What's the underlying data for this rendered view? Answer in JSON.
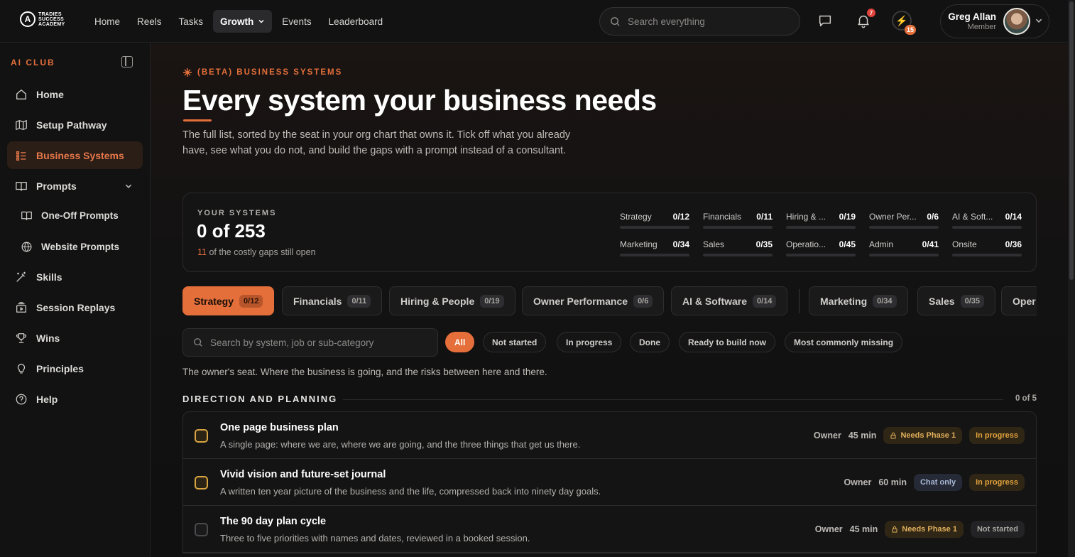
{
  "brand": {
    "mark": "A",
    "line1": "TRADIES",
    "line2": "SUCCESS",
    "line3": "ACADEMY"
  },
  "nav": [
    {
      "label": "Home"
    },
    {
      "label": "Reels"
    },
    {
      "label": "Tasks"
    },
    {
      "label": "Growth"
    },
    {
      "label": "Events"
    },
    {
      "label": "Leaderboard"
    }
  ],
  "search": {
    "placeholder": "Search everything"
  },
  "notifications": {
    "count": "7"
  },
  "streak": {
    "count": "15"
  },
  "user": {
    "name": "Greg Allan",
    "role": "Member"
  },
  "sidebar": {
    "title": "AI CLUB",
    "items": [
      {
        "label": "Home",
        "icon": "home-icon"
      },
      {
        "label": "Setup Pathway",
        "icon": "map-icon"
      },
      {
        "label": "Business Systems",
        "icon": "list-icon"
      },
      {
        "label": "Prompts",
        "icon": "book-icon"
      },
      {
        "label": "One-Off Prompts",
        "icon": "book-open-icon"
      },
      {
        "label": "Website Prompts",
        "icon": "globe-icon"
      },
      {
        "label": "Skills",
        "icon": "wand-icon"
      },
      {
        "label": "Session Replays",
        "icon": "replay-icon"
      },
      {
        "label": "Wins",
        "icon": "trophy-icon"
      },
      {
        "label": "Principles",
        "icon": "lightbulb-icon"
      },
      {
        "label": "Help",
        "icon": "help-icon"
      }
    ]
  },
  "page": {
    "kicker": "(BETA) BUSINESS SYSTEMS",
    "title": "Every system your business needs",
    "lede": "The full list, sorted by the seat in your org chart that owns it. Tick off what you already have, see what you do not, and build the gaps with a prompt instead of a consultant."
  },
  "stats": {
    "label": "YOUR SYSTEMS",
    "total": "0 of 253",
    "gaps_count": "11",
    "gaps_text": " of the costly gaps still open",
    "categories": [
      {
        "name": "Strategy",
        "count": "0/12",
        "progress": 0
      },
      {
        "name": "Financials",
        "count": "0/11",
        "progress": 0
      },
      {
        "name": "Hiring & ...",
        "count": "0/19",
        "progress": 0
      },
      {
        "name": "Owner Per...",
        "count": "0/6",
        "progress": 0
      },
      {
        "name": "AI & Soft...",
        "count": "0/14",
        "progress": 0
      },
      {
        "name": "Marketing",
        "count": "0/34",
        "progress": 0
      },
      {
        "name": "Sales",
        "count": "0/35",
        "progress": 0
      },
      {
        "name": "Operatio...",
        "count": "0/45",
        "progress": 0
      },
      {
        "name": "Admin",
        "count": "0/41",
        "progress": 0
      },
      {
        "name": "Onsite",
        "count": "0/36",
        "progress": 0
      }
    ]
  },
  "tabs": [
    {
      "label": "Strategy",
      "count": "0/12"
    },
    {
      "label": "Financials",
      "count": "0/11"
    },
    {
      "label": "Hiring & People",
      "count": "0/19"
    },
    {
      "label": "Owner Performance",
      "count": "0/6"
    },
    {
      "label": "AI & Software",
      "count": "0/14"
    },
    {
      "label": "Marketing",
      "count": "0/34"
    },
    {
      "label": "Sales",
      "count": "0/35"
    },
    {
      "label": "Oper",
      "count": ""
    }
  ],
  "filters": {
    "search_placeholder": "Search by system, job or sub-category",
    "chips": [
      "All",
      "Not started",
      "In progress",
      "Done",
      "Ready to build now",
      "Most commonly missing"
    ]
  },
  "seat_description": "The owner's seat. Where the business is going, and the risks between here and there.",
  "section": {
    "title": "DIRECTION AND PLANNING",
    "count": "0 of 5"
  },
  "systems": [
    {
      "title": "One page business plan",
      "desc": "A single page: where we are, where we are going, and the three things that get us there.",
      "owner": "Owner",
      "time": "45 min",
      "tag": "Needs Phase 1",
      "status": "In progress"
    },
    {
      "title": "Vivid vision and future-set journal",
      "desc": "A written ten year picture of the business and the life, compressed back into ninety day goals.",
      "owner": "Owner",
      "time": "60 min",
      "tag": "Chat only",
      "status": "In progress"
    },
    {
      "title": "The 90 day plan cycle",
      "desc": "Three to five priorities with names and dates, reviewed in a booked session.",
      "owner": "Owner",
      "time": "45 min",
      "tag": "Needs Phase 1",
      "status": "Not started"
    }
  ]
}
